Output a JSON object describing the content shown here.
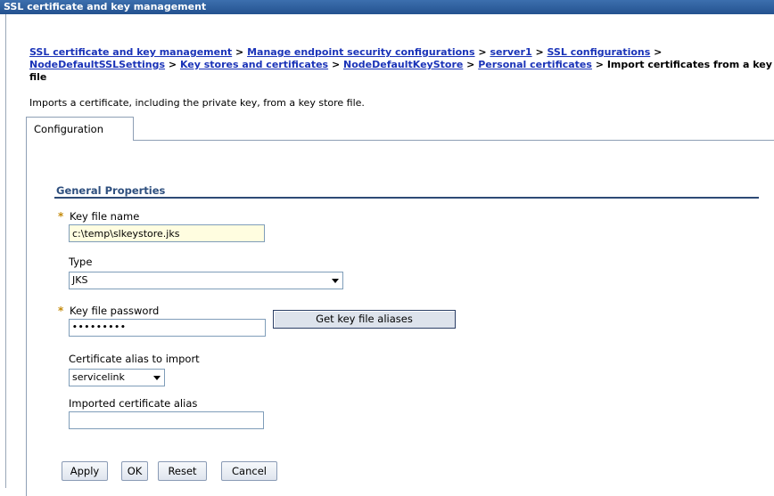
{
  "window": {
    "title": "SSL certificate and key management"
  },
  "breadcrumb": {
    "links": [
      "SSL certificate and key management",
      "Manage endpoint security configurations",
      "server1",
      "SSL configurations",
      "NodeDefaultSSLSettings",
      "Key stores and certificates",
      "NodeDefaultKeyStore",
      "Personal certificates"
    ],
    "separator": " > ",
    "current": "Import certificates from a key file"
  },
  "description": "Imports a certificate, including the private key, from a key store file.",
  "tabs": [
    {
      "label": "Configuration"
    }
  ],
  "general_properties": {
    "title": "General Properties",
    "required_marker": "*",
    "key_file_name": {
      "label": "Key file name",
      "value": "c:\\temp\\slkeystore.jks"
    },
    "type": {
      "label": "Type",
      "value": "JKS"
    },
    "key_file_password": {
      "label": "Key file password",
      "value": "•••••••••"
    },
    "get_aliases_button": "Get key file aliases",
    "certificate_alias": {
      "label": "Certificate alias to import",
      "value": "servicelink"
    },
    "imported_alias": {
      "label": "Imported certificate alias",
      "value": ""
    }
  },
  "buttons": {
    "apply": "Apply",
    "ok": "OK",
    "reset": "Reset",
    "cancel": "Cancel"
  }
}
